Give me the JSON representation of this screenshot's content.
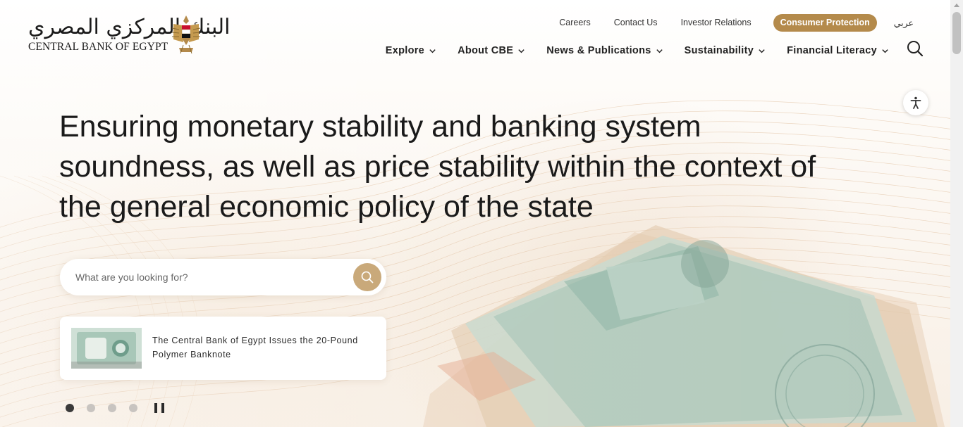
{
  "logo": {
    "arabic": "البنك المركزي المصري",
    "english": "CENTRAL BANK OF EGYPT",
    "emblem_icon": "egypt-eagle-emblem-icon"
  },
  "top_links": {
    "careers": "Careers",
    "contact": "Contact Us",
    "investor": "Investor Relations",
    "consumer": "Consumer Protection",
    "language": "عربي"
  },
  "nav": {
    "items": [
      {
        "label": "Explore"
      },
      {
        "label": "About CBE"
      },
      {
        "label": "News & Publications"
      },
      {
        "label": "Sustainability"
      },
      {
        "label": "Financial Literacy"
      }
    ]
  },
  "hero": {
    "title": "Ensuring monetary stability and banking system soundness, as well as price stability within the context of the general economic policy of the state"
  },
  "search": {
    "placeholder": "What are you looking for?",
    "value": ""
  },
  "news": {
    "headline": "The Central Bank of Egypt Issues the 20-Pound Polymer Banknote"
  },
  "slider": {
    "slide_count": 4,
    "active_index": 0
  },
  "colors": {
    "accent": "#b48a4b",
    "search_button": "#c9a97a",
    "text": "#1a1a1a"
  },
  "icons": {
    "search": "search-icon",
    "accessibility": "accessibility-icon",
    "chevron": "chevron-down-icon",
    "pause": "pause-icon"
  }
}
